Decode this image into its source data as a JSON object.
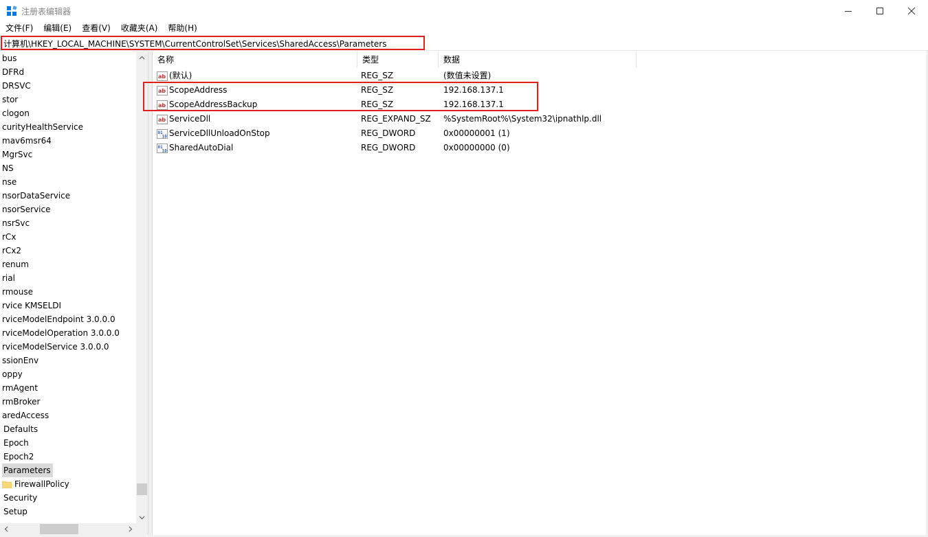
{
  "window": {
    "title": "注册表编辑器",
    "accent": "#0078d7"
  },
  "menu": [
    {
      "label": "文件(F)"
    },
    {
      "label": "编辑(E)"
    },
    {
      "label": "查看(V)"
    },
    {
      "label": "收藏夹(A)"
    },
    {
      "label": "帮助(H)"
    }
  ],
  "address": {
    "path": "计算机\\HKEY_LOCAL_MACHINE\\SYSTEM\\CurrentControlSet\\Services\\SharedAccess\\Parameters"
  },
  "tree": {
    "items": [
      {
        "label": "bus"
      },
      {
        "label": "DFRd"
      },
      {
        "label": "DRSVC"
      },
      {
        "label": "stor"
      },
      {
        "label": "clogon"
      },
      {
        "label": "curityHealthService"
      },
      {
        "label": "mav6msr64"
      },
      {
        "label": "MgrSvc"
      },
      {
        "label": "NS"
      },
      {
        "label": "nse"
      },
      {
        "label": "nsorDataService"
      },
      {
        "label": "nsorService"
      },
      {
        "label": "nsrSvc"
      },
      {
        "label": "rCx"
      },
      {
        "label": "rCx2"
      },
      {
        "label": "renum"
      },
      {
        "label": "rial"
      },
      {
        "label": "rmouse"
      },
      {
        "label": "rvice KMSELDI"
      },
      {
        "label": "rviceModelEndpoint 3.0.0.0"
      },
      {
        "label": "rviceModelOperation 3.0.0.0"
      },
      {
        "label": "rviceModelService 3.0.0.0"
      },
      {
        "label": "ssionEnv"
      },
      {
        "label": "oppy"
      },
      {
        "label": "rmAgent"
      },
      {
        "label": "rmBroker"
      },
      {
        "label": "aredAccess"
      },
      {
        "label": "Defaults"
      },
      {
        "label": "Epoch"
      },
      {
        "label": "Epoch2"
      },
      {
        "label": "Parameters",
        "selected": true
      },
      {
        "label": "FirewallPolicy",
        "folder": true
      },
      {
        "label": "Security"
      },
      {
        "label": "Setup"
      }
    ]
  },
  "list": {
    "headers": {
      "name": "名称",
      "type": "类型",
      "data": "数据"
    },
    "rows": [
      {
        "icon": "string-value-icon",
        "name": "(默认)",
        "type": "REG_SZ",
        "data": "(数值未设置)"
      },
      {
        "icon": "string-value-icon",
        "name": "ScopeAddress",
        "type": "REG_SZ",
        "data": "192.168.137.1"
      },
      {
        "icon": "string-value-icon",
        "name": "ScopeAddressBackup",
        "type": "REG_SZ",
        "data": "192.168.137.1"
      },
      {
        "icon": "string-value-icon",
        "name": "ServiceDll",
        "type": "REG_EXPAND_SZ",
        "data": "%SystemRoot%\\System32\\ipnathlp.dll"
      },
      {
        "icon": "binary-value-icon",
        "name": "ServiceDllUnloadOnStop",
        "type": "REG_DWORD",
        "data": "0x00000001 (1)"
      },
      {
        "icon": "binary-value-icon",
        "name": "SharedAutoDial",
        "type": "REG_DWORD",
        "data": "0x00000000 (0)"
      }
    ]
  },
  "colors": {
    "highlight": "#e02020",
    "selection": "#d9d9d9"
  }
}
